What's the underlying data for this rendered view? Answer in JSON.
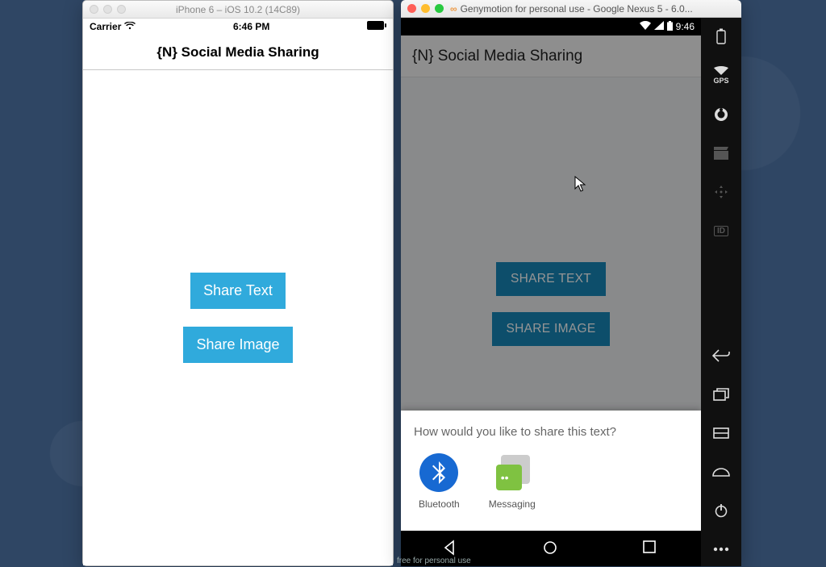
{
  "ios": {
    "window_title": "iPhone 6 – iOS 10.2 (14C89)",
    "status": {
      "carrier": "Carrier",
      "time": "6:46 PM"
    },
    "app_title": "{N} Social Media Sharing",
    "buttons": {
      "share_text": "Share Text",
      "share_image": "Share Image"
    }
  },
  "android": {
    "window_title": "Genymotion for personal use - Google Nexus 5 - 6.0...",
    "status_time": "9:46",
    "app_title": "{N} Social Media Sharing",
    "buttons": {
      "share_text": "SHARE TEXT",
      "share_image": "SHARE IMAGE"
    },
    "sheet": {
      "prompt": "How would you like to share this text?",
      "options": [
        {
          "label": "Bluetooth",
          "icon": "bluetooth"
        },
        {
          "label": "Messaging",
          "icon": "messaging"
        }
      ]
    },
    "sidebar_labels": {
      "gps": "GPS",
      "id": "ID"
    }
  },
  "footer": "free for personal use",
  "colors": {
    "ios_button": "#30aadc",
    "android_button": "#1887b9"
  }
}
